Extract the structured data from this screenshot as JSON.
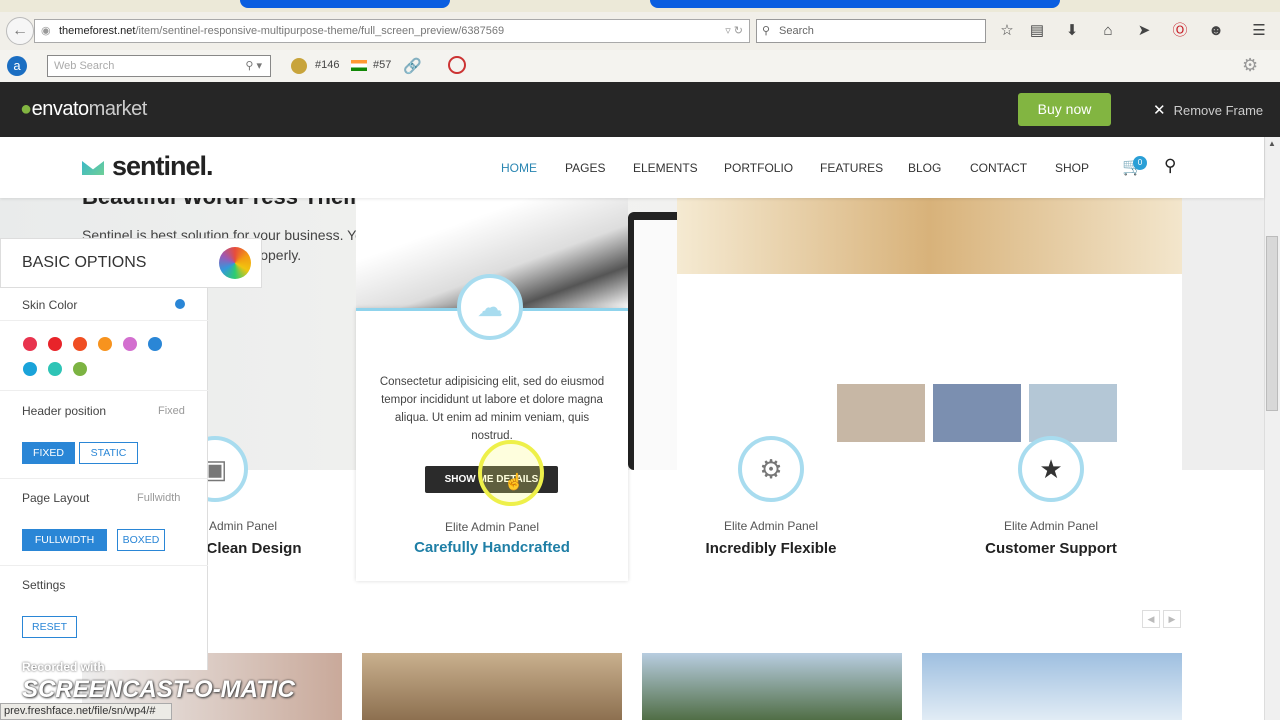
{
  "browser": {
    "url_domain": "themeforest.net",
    "url_path": "/item/sentinel-responsive-multipurpose-theme/full_screen_preview/6387569",
    "search_placeholder": "Search",
    "web_search_placeholder": "Web Search",
    "rank_global": "#146",
    "rank_country": "#57",
    "status_url": "prev.freshface.net/file/sn/wp4/#"
  },
  "envato": {
    "logo_main": "envato",
    "logo_market": "market",
    "buy_now": "Buy now",
    "remove_frame": "Remove Frame"
  },
  "site": {
    "logo": "sentinel.",
    "nav": [
      "HOME",
      "PAGES",
      "ELEMENTS",
      "PORTFOLIO",
      "FEATURES",
      "BLOG",
      "CONTACT",
      "SHOP"
    ],
    "cart_count": "0"
  },
  "hero": {
    "title": "Beautiful WordPress Theme",
    "text": "Sentinel is best solution for your business. You can present your products properly."
  },
  "card": {
    "text": "Consectetur adipisicing elit, sed do eiusmod tempor incididunt ut labore et dolore magna aliqua. Ut enim ad minim veniam, quis nostrud.",
    "button": "SHOW ME DETAILS"
  },
  "features": [
    {
      "sub": "Elite Admin Panel",
      "title": "Clean Design"
    },
    {
      "sub": "Elite Admin Panel",
      "title": "Carefully Handcrafted"
    },
    {
      "sub": "Elite Admin Panel",
      "title": "Incredibly Flexible"
    },
    {
      "sub": "Elite Admin Panel",
      "title": "Customer Support"
    }
  ],
  "options": {
    "title": "BASIC OPTIONS",
    "skin_color": "Skin Color",
    "header_position": "Header position",
    "header_value": "Fixed",
    "fixed": "FIXED",
    "static": "STATIC",
    "page_layout": "Page Layout",
    "layout_value": "Fullwidth",
    "fullwidth": "FULLWIDTH",
    "boxed": "BOXED",
    "settings": "Settings",
    "reset": "RESET",
    "swatches": [
      "#e8344e",
      "#e8242a",
      "#f04e23",
      "#f7931e",
      "#d36fcf",
      "#2a86d6",
      "#1aa3d9",
      "#2ec4b6",
      "#7cb342"
    ]
  },
  "watermark": {
    "line1": "Recorded with",
    "line2": "SCREENCAST-O-MATIC"
  }
}
